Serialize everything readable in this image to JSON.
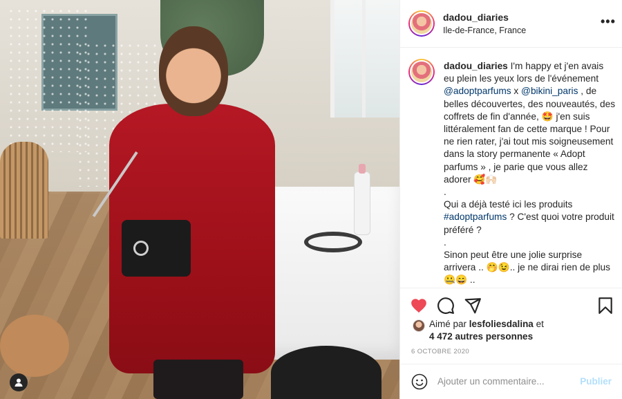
{
  "post": {
    "photo_alt": "Woman in red dress at event",
    "user_tag_icon": "user-tag-icon"
  },
  "header": {
    "username": "dadou_diaries",
    "location": "Ile-de-France, France",
    "more_icon": "more-options-icon",
    "more_label": "•••"
  },
  "caption": {
    "username": "dadou_diaries",
    "line1": "I'm happy et j'en avais eu plein les yeux lors de l'événement",
    "mention1": "@adoptparfums",
    "x": " x ",
    "mention2": "@bikini_paris",
    "line2": " , de belles découvertes, des nouveautés, des coffrets de fin d'année, 🤩 j'en suis littéralement fan de cette marque ! Pour ne rien rater, j'ai tout mis soigneusement dans la story permanente « Adopt parfums » , je parie que vous allez adorer 🥰🙌🏻",
    "dot1": ".",
    "line3": "Qui a déjà testé ici les produits",
    "hashtag": "#adoptparfums",
    "line4": " ? C'est quoi votre produit préféré ?",
    "dot2": ".",
    "line5": "Sinon peut être une jolie surprise arrivera .. 🤭😉.. je ne dirai rien de plus 🤐😄 ..",
    "dot3": "."
  },
  "actions": {
    "like_icon": "heart-icon",
    "comment_icon": "comment-icon",
    "share_icon": "share-icon",
    "save_icon": "bookmark-icon",
    "like_color": "#ed4956"
  },
  "likes": {
    "prefix": "Aimé par ",
    "user": "lesfoliesdalina",
    "suffix": " et",
    "others": "4 472 autres personnes"
  },
  "date": "6 OCTOBRE 2020",
  "comment": {
    "placeholder": "Ajouter un commentaire...",
    "publish": "Publier",
    "emoji_icon": "smiley-icon",
    "publish_color": "#b2dffc"
  }
}
